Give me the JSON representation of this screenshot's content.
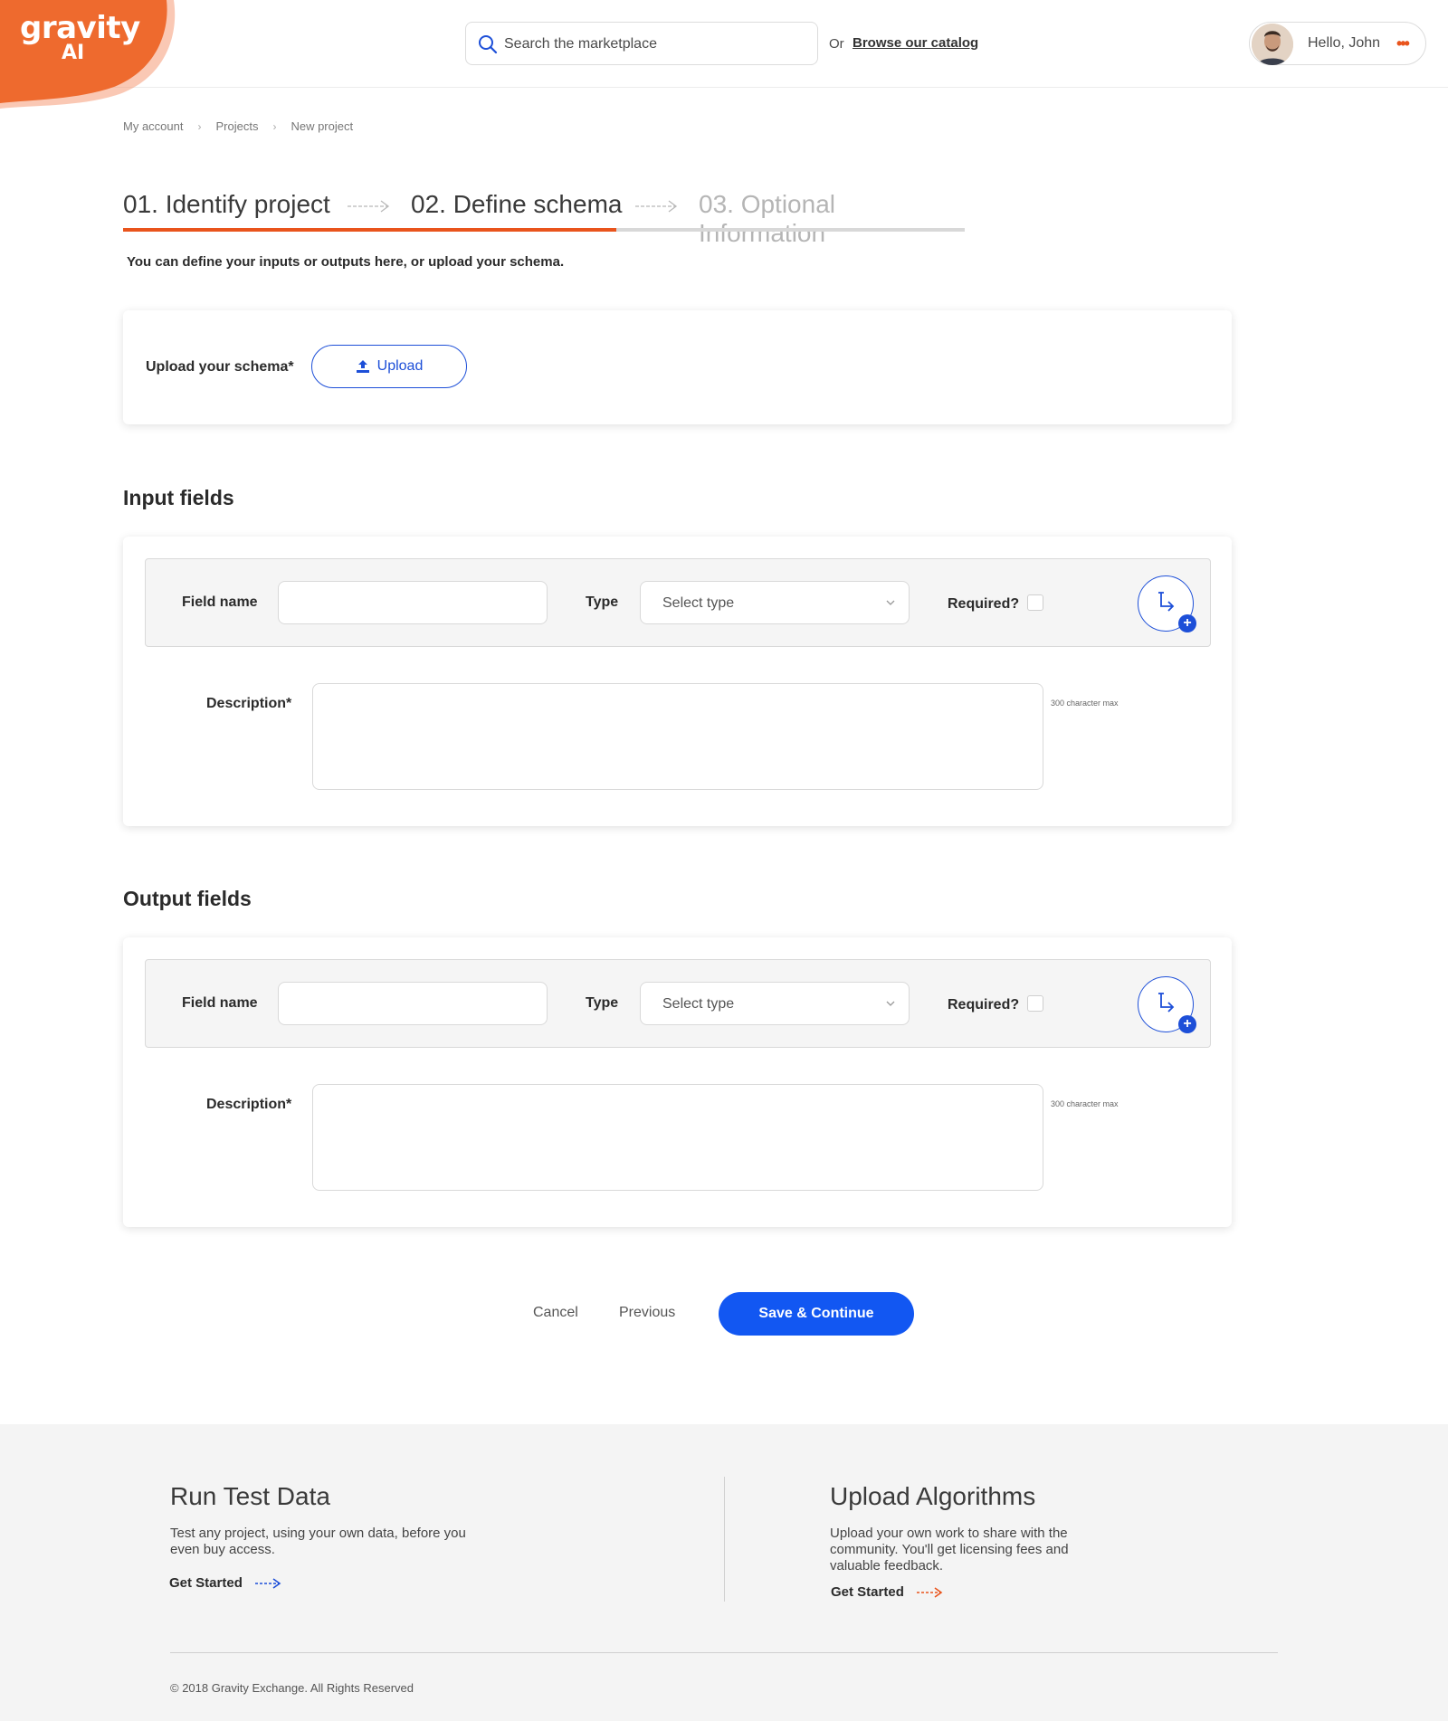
{
  "brand": {
    "logo_text": "gravity",
    "logo_sub": "AI",
    "accent_color": "#e9541c",
    "primary_color": "#1257f2"
  },
  "header": {
    "search_placeholder": "Search the marketplace",
    "or_text": "Or",
    "browse_link": "Browse our catalog",
    "greeting": "Hello, John",
    "more_glyph": "•••"
  },
  "breadcrumb": [
    "My account",
    "Projects",
    "New project"
  ],
  "steps": [
    {
      "label": "01. Identify project",
      "state": "complete"
    },
    {
      "label": "02. Define schema",
      "state": "current"
    },
    {
      "label": "03. Optional Information",
      "state": "upcoming"
    }
  ],
  "progress_fraction": 0.586,
  "intro_text": "You can define your inputs or outputs here, or upload your schema.",
  "upload": {
    "label": "Upload your schema*",
    "button_label": "Upload"
  },
  "input_fields": {
    "title": "Input fields",
    "field_name_label": "Field name",
    "field_name_value": "",
    "type_label": "Type",
    "type_value": "Select type",
    "required_label": "Required?",
    "required_checked": false,
    "description_label": "Description*",
    "description_value": "",
    "char_max": "300 character max"
  },
  "output_fields": {
    "title": "Output fields",
    "field_name_label": "Field name",
    "field_name_value": "",
    "type_label": "Type",
    "type_value": "Select type",
    "required_label": "Required?",
    "required_checked": false,
    "description_label": "Description*",
    "description_value": "",
    "char_max": "300 character max"
  },
  "actions": {
    "cancel": "Cancel",
    "previous": "Previous",
    "save": "Save & Continue"
  },
  "footer": {
    "promo_left": {
      "title": "Run Test Data",
      "text": "Test any project, using your own data, before you even buy access.",
      "cta": "Get Started"
    },
    "promo_right": {
      "title": "Upload Algorithms",
      "text": "Upload your own work to share with the community. You'll get licensing fees and valuable feedback.",
      "cta": "Get Started"
    },
    "copyright": "© 2018 Gravity Exchange. All Rights Reserved"
  }
}
